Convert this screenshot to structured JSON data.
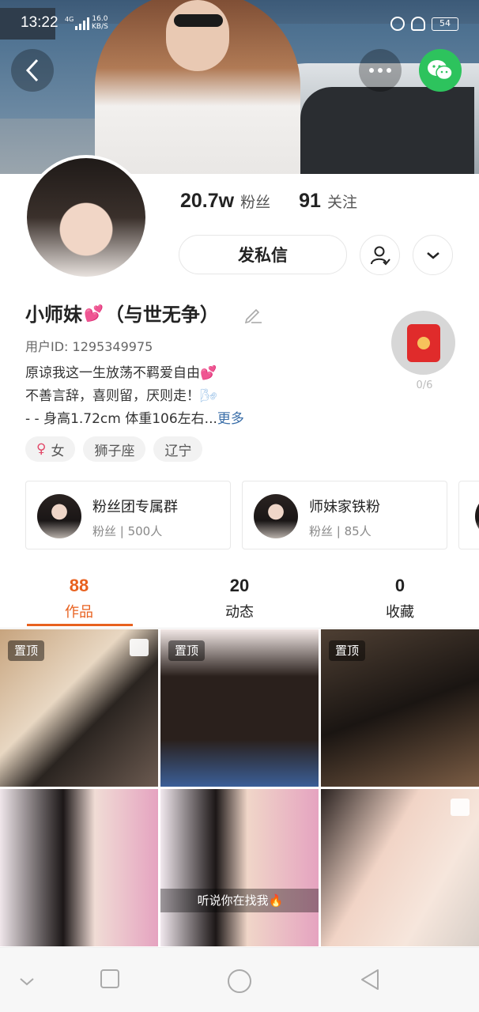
{
  "status_bar": {
    "time": "13:22",
    "network": "4G",
    "speed_value": "16.0",
    "speed_unit": "KB/S",
    "battery": "54"
  },
  "profile": {
    "fans_count": "20.7w",
    "fans_label": "粉丝",
    "following_count": "91",
    "following_label": "关注",
    "message_button": "发私信",
    "name_part1": "小师妹",
    "name_part2": "（与世无争）",
    "user_id": "用户ID: 1295349975",
    "bio_line1": "原谅我这一生放荡不羁爱自由",
    "bio_line2": "不善言辞，喜则留，厌则走！",
    "bio_line3": "- - 身高1.72cm 体重106左右...",
    "bio_more": "更多",
    "red_packet_count": "0/6"
  },
  "tags": [
    "女",
    "狮子座",
    "辽宁"
  ],
  "groups": [
    {
      "name": "粉丝团专属群",
      "info": "粉丝 | 500人"
    },
    {
      "name": "师妹家铁粉",
      "info": "粉丝 | 85人"
    }
  ],
  "tabs": [
    {
      "count": "88",
      "label": "作品"
    },
    {
      "count": "20",
      "label": "动态"
    },
    {
      "count": "0",
      "label": "收藏"
    }
  ],
  "grid": {
    "pinned_label": "置顶",
    "caption": "听说你在找我🔥"
  },
  "colors": {
    "accent": "#e8611f",
    "wechat": "#2dc35d",
    "link": "#3a6ea8"
  }
}
